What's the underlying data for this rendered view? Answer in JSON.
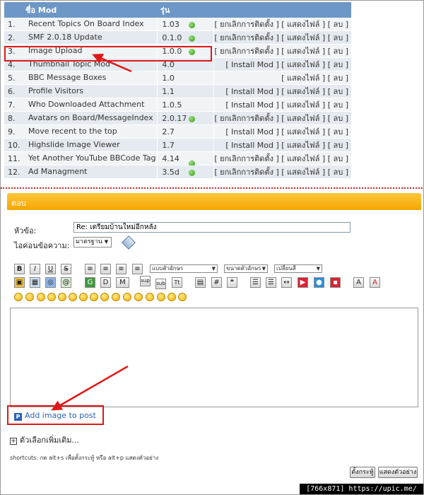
{
  "mod_table": {
    "headers": {
      "name": "ชื่อ Mod",
      "version": "รุ่น"
    },
    "rows": [
      {
        "num": "1.",
        "name": "Recent Topics On Board Index",
        "version": "1.03",
        "installed": true,
        "actions": "[ ยกเลิกการติดตั้ง ] [ แสดงไฟล์ ] [ ลบ ]"
      },
      {
        "num": "2.",
        "name": "SMF 2.0.18 Update",
        "version": "0.1.0",
        "installed": true,
        "actions": "[ ยกเลิกการติดตั้ง ] [ แสดงไฟล์ ] [ ลบ ]"
      },
      {
        "num": "3.",
        "name": "Image Upload",
        "version": "1.0.0",
        "installed": true,
        "actions": "[ ยกเลิกการติดตั้ง ] [ แสดงไฟล์ ] [ ลบ ]"
      },
      {
        "num": "4.",
        "name": "Thumbnail Topic Mod",
        "version": "4.0",
        "installed": false,
        "actions": "[ Install Mod ] [ แสดงไฟล์ ] [ ลบ ]"
      },
      {
        "num": "5.",
        "name": "BBC Message Boxes",
        "version": "1.0",
        "installed": false,
        "actions": "[ แสดงไฟล์ ] [ ลบ ]"
      },
      {
        "num": "6.",
        "name": "Profile Visitors",
        "version": "1.1",
        "installed": false,
        "actions": "[ Install Mod ] [ แสดงไฟล์ ] [ ลบ ]"
      },
      {
        "num": "7.",
        "name": "Who Downloaded Attachment",
        "version": "1.0.5",
        "installed": false,
        "actions": "[ Install Mod ] [ แสดงไฟล์ ] [ ลบ ]"
      },
      {
        "num": "8.",
        "name": "Avatars on Board/MessageIndex",
        "version": "2.0.17",
        "installed": true,
        "actions": "[ ยกเลิกการติดตั้ง ] [ แสดงไฟล์ ] [ ลบ ]"
      },
      {
        "num": "9.",
        "name": "Move recent to the top",
        "version": "2.7",
        "installed": false,
        "actions": "[ Install Mod ] [ แสดงไฟล์ ] [ ลบ ]"
      },
      {
        "num": "10.",
        "name": "Highslide Image Viewer",
        "version": "1.7",
        "installed": false,
        "actions": "[ Install Mod ] [ แสดงไฟล์ ] [ ลบ ]"
      },
      {
        "num": "11.",
        "name": "Yet Another YouTube BBCode Tag",
        "version": "4.14",
        "installed": true,
        "actions": "[ ยกเลิกการติดตั้ง ] [ แสดงไฟล์ ] [ ลบ ]"
      },
      {
        "num": "12.",
        "name": "Ad Managment",
        "version": "3.5d",
        "installed": true,
        "actions": "[ ยกเลิกการติดตั้ง ] [ แสดงไฟล์ ] [ ลบ ]"
      }
    ]
  },
  "reply": {
    "header": "ตอบ",
    "subject_label": "หัวข้อ:",
    "subject_value": "Re: เตรียมบ้านใหม่อีกหลัง",
    "icon_label": "ไอค่อนข้อความ:",
    "icon_value": "มาตรฐาน",
    "toolbar": {
      "bold": "B",
      "italic": "I",
      "underline": "U",
      "strike": "S",
      "face_select": "แบบตัวอักษร",
      "size_select": "ขนาดตัวอักษร",
      "color_select": "เปลี่ยนสี",
      "sup": "sup",
      "sub": "sub",
      "tt": "Tt"
    },
    "add_image_label": "Add image to post",
    "more_options": "ตัวเลือกเพิ่มเติม...",
    "shortcuts": "shortcuts: กด alt+s เพื่อตั้งกระทู้ หรือ alt+p แสดงตัวอย่าง",
    "post_button": "ตั้งกระทู้",
    "preview_button": "แสดงตัวอย่าง"
  },
  "watermark": "[766x871] https://upic.me/",
  "colors": {
    "accent": "#f3a600",
    "table_header": "#6d97c7",
    "highlight": "#e01818",
    "link": "#2a62b8"
  }
}
